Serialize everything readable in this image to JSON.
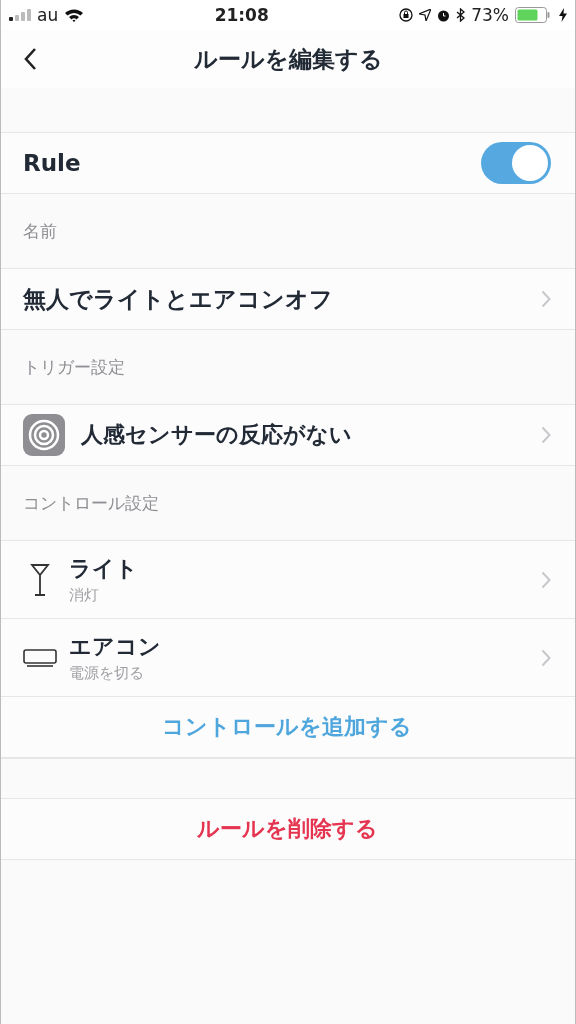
{
  "status_bar": {
    "carrier": "au",
    "time": "21:08",
    "battery": "73%"
  },
  "nav": {
    "title": "ルールを編集する"
  },
  "rule": {
    "label": "Rule",
    "on": true
  },
  "name_section": {
    "header": "名前",
    "value": "無人でライトとエアコンオフ"
  },
  "trigger_section": {
    "header": "トリガー設定",
    "trigger": "人感センサーの反応がない"
  },
  "control_section": {
    "header": "コントロール設定",
    "controls": [
      {
        "kind": "light",
        "name": "ライト",
        "action": "消灯"
      },
      {
        "kind": "aircon",
        "name": "エアコン",
        "action": "電源を切る"
      }
    ],
    "add": "コントロールを追加する"
  },
  "delete": "ルールを削除する"
}
